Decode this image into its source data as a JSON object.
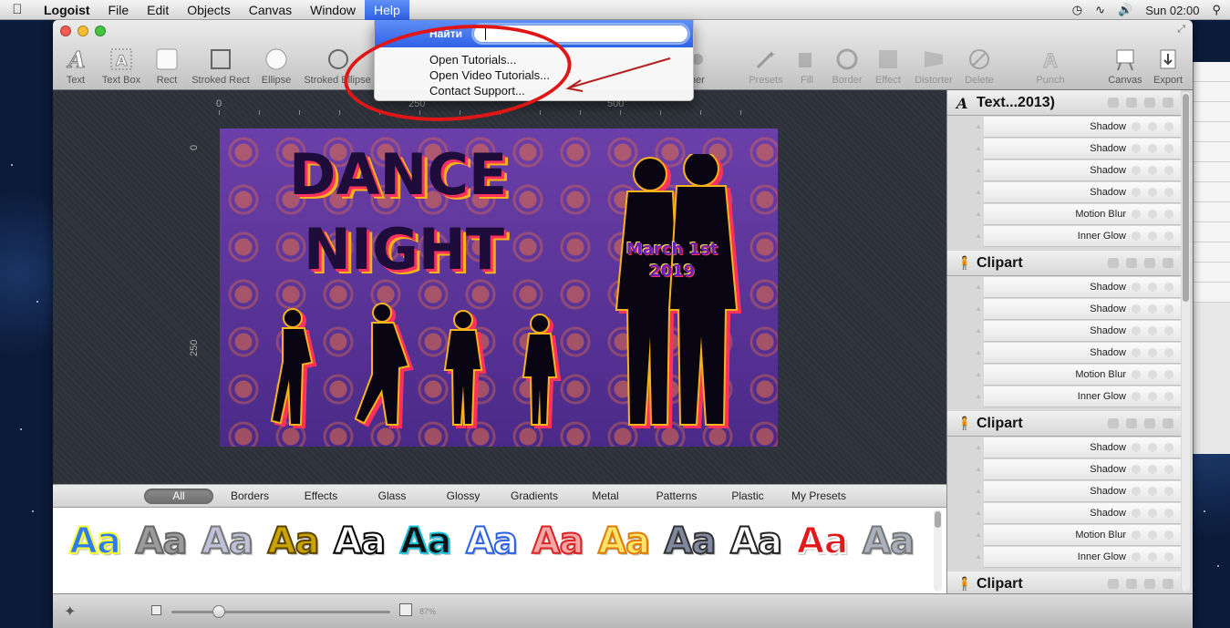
{
  "menubar": {
    "app_name": "Logoist",
    "items": [
      "File",
      "Edit",
      "Objects",
      "Canvas",
      "Window"
    ],
    "active_item": "Help",
    "clock": "Sun 02:00"
  },
  "help_menu": {
    "search_label": "Найти",
    "search_value": "",
    "items": [
      "Open Tutorials...",
      "Open Video Tutorials...",
      "Contact Support..."
    ]
  },
  "toolbar": {
    "left_tools": [
      "Text",
      "Text Box",
      "Rect",
      "Stroked Rect",
      "Ellipse",
      "Stroked Ellipse"
    ],
    "partial_tool": "ner",
    "right_tools": [
      "Presets",
      "Fill",
      "Border",
      "Effect",
      "Distorter",
      "Delete",
      "Punch",
      "Canvas",
      "Export"
    ]
  },
  "rulers": {
    "top": [
      "0",
      "250",
      "500"
    ],
    "left": [
      "0",
      "250"
    ]
  },
  "canvas": {
    "title_line1": "DANCE",
    "title_line2": "NIGHT",
    "date_line1": "March 1st",
    "date_line2": "2019"
  },
  "layers": [
    {
      "name": "Text...2013)",
      "icon": "text-layer-icon",
      "effects": [
        "Shadow",
        "Shadow",
        "Shadow",
        "Shadow",
        "Motion Blur",
        "Inner Glow"
      ]
    },
    {
      "name": "Clipart",
      "icon": "person-silhouette-icon",
      "effects": [
        "Shadow",
        "Shadow",
        "Shadow",
        "Shadow",
        "Motion Blur",
        "Inner Glow"
      ]
    },
    {
      "name": "Clipart",
      "icon": "person-silhouette-icon",
      "effects": [
        "Shadow",
        "Shadow",
        "Shadow",
        "Shadow",
        "Motion Blur",
        "Inner Glow"
      ]
    },
    {
      "name": "Clipart",
      "icon": "person-silhouette-icon",
      "effects": []
    }
  ],
  "preset_tabs": [
    "All",
    "Borders",
    "Effects",
    "Glass",
    "Glossy",
    "Gradients",
    "Metal",
    "Patterns",
    "Plastic",
    "My Presets"
  ],
  "preset_active": "All",
  "preset_sample": "Aa",
  "preset_styles": [
    {
      "fill": "#2d7cf0",
      "stroke": "#ff3"
    },
    {
      "fill": "#9a9a9a",
      "stroke": "#666"
    },
    {
      "fill": "#c0c0d8",
      "stroke": "#777"
    },
    {
      "fill": "#c9a400",
      "stroke": "#5b4200"
    },
    {
      "fill": "#ffffff",
      "stroke": "#000"
    },
    {
      "fill": "#111111",
      "stroke": "#19c0d8"
    },
    {
      "fill": "#ffffff",
      "stroke": "#2a60e8"
    },
    {
      "fill": "#f5a7a7",
      "stroke": "#d22"
    },
    {
      "fill": "#ffe36b",
      "stroke": "#e07b00"
    },
    {
      "fill": "#8088a0",
      "stroke": "#333"
    },
    {
      "fill": "#ffffff",
      "stroke": "#222"
    },
    {
      "fill": "#e01a1a",
      "stroke": "#fff"
    },
    {
      "fill": "#aab0bd",
      "stroke": "#777"
    }
  ],
  "zoom": {
    "label": "87%",
    "value_percent": 87
  }
}
